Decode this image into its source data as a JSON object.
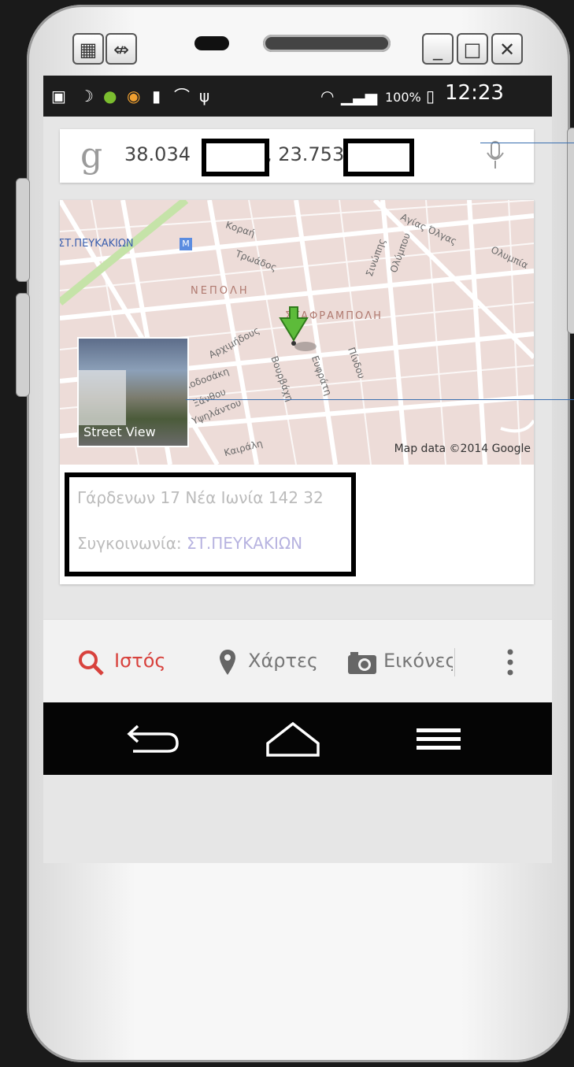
{
  "window_controls": {
    "minimize": "_",
    "maximize": "□",
    "close": "✕"
  },
  "status": {
    "battery_pct": "100%",
    "time": "12:23"
  },
  "search": {
    "query_left": "38.034",
    "query_mid": ", 23.753"
  },
  "map": {
    "attribution": "Map data ©2014 Google",
    "street_view_label": "Street View",
    "labels": {
      "metro": "ΣΤ.ΠΕΥΚΑΚΙΩΝ",
      "neighborhood1": "ΝΕΠΟΛΗ",
      "neighborhood2": "ΣΤΑΦΡΑΜΠΟΛΗ",
      "road1": "Κοραή",
      "road2": "Τρωάδος",
      "road3": "Αρχιμήδους",
      "road4": "Σινώπης",
      "road5": "Ολύμπου",
      "road6": "Αγίας Όλγας",
      "road7": "Ολυμπία",
      "road8": "Βουρβάχη",
      "road9": "Υψηλάντου",
      "road10": "Ξάνθου",
      "road11": "Καιράλη",
      "road12": "Πίνδου",
      "road13": "Ευφράτη",
      "road14": "Κοδοσάκη"
    }
  },
  "result": {
    "address": "Γάρδενων 17 Νέα Ιωνία 142 32",
    "nearby_prefix": "Συγκοινωνία: ",
    "nearby_station": "ΣΤ.ΠΕΥΚΑΚΙΩΝ"
  },
  "tabs": [
    {
      "label": "Ιστός",
      "color": "#d8423d"
    },
    {
      "label": "Χάρτες",
      "color": "#777777"
    },
    {
      "label": "Εικόνες",
      "color": "#777777"
    }
  ],
  "colors": {
    "accent": "#d8423d",
    "pin": "#5dbb3a"
  }
}
